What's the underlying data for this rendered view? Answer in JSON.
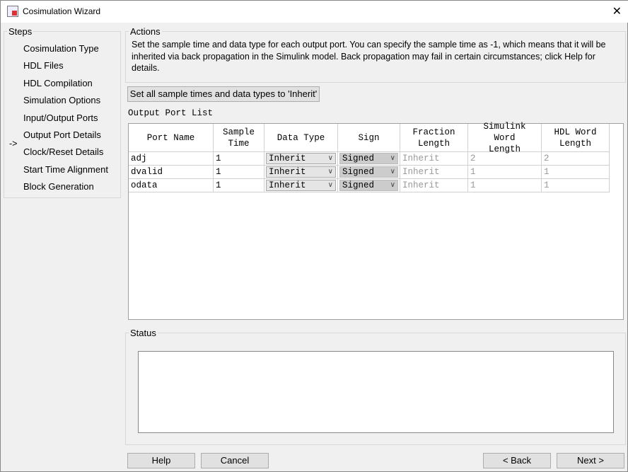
{
  "window": {
    "title": "Cosimulation Wizard",
    "close": "✕"
  },
  "steps": {
    "legend": "Steps",
    "current_marker": "->",
    "items": [
      "Cosimulation Type",
      "HDL Files",
      "HDL Compilation",
      "Simulation Options",
      "Input/Output Ports",
      "Output Port Details",
      "Clock/Reset Details",
      "Start Time Alignment",
      "Block Generation"
    ]
  },
  "actions": {
    "legend": "Actions",
    "text": "Set the sample time and data type for each output port. You can specify the sample time as -1, which means that it will be inherited via back propagation in the Simulink model. Back propagation may fail in certain circumstances; click Help for details."
  },
  "inherit_button": "Set all sample times and data types to 'Inherit'",
  "list_label": "Output Port List",
  "table": {
    "headers": [
      "Port Name",
      "Sample Time",
      "Data Type",
      "Sign",
      "Fraction Length",
      "Simulink Word Length",
      "HDL Word Length"
    ],
    "rows": [
      [
        "adj",
        "1",
        "Inherit",
        "Signed",
        "Inherit",
        "2",
        "2"
      ],
      [
        "dvalid",
        "1",
        "Inherit",
        "Signed",
        "Inherit",
        "1",
        "1"
      ],
      [
        "odata",
        "1",
        "Inherit",
        "Signed",
        "Inherit",
        "1",
        "1"
      ]
    ]
  },
  "status": {
    "legend": "Status",
    "text": ""
  },
  "buttons": {
    "help": "Help",
    "cancel": "Cancel",
    "back": "< Back",
    "next": "Next >"
  }
}
